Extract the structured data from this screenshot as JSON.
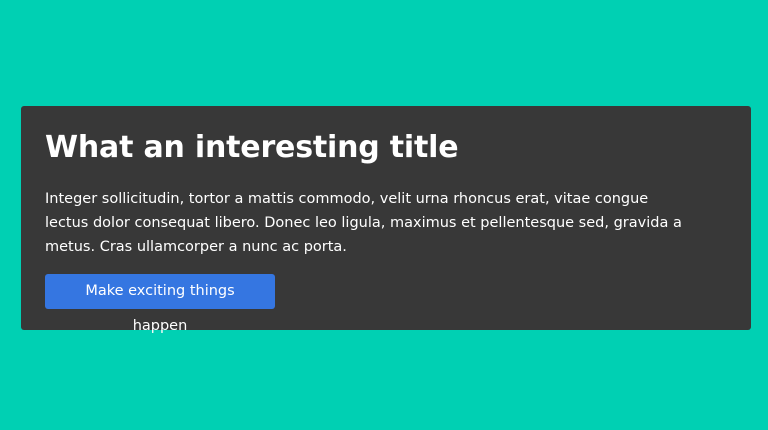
{
  "page": {
    "background_color": "#00d0b3"
  },
  "card": {
    "background_color": "#383838",
    "title": "What an interesting title",
    "body": "Integer sollicitudin, tortor a mattis commodo, velit urna rhoncus erat, vitae congue lectus dolor consequat libero. Donec leo ligula, maximus et pellentesque sed, gravida a metus. Cras ullamcorper a nunc ac porta.",
    "button": {
      "label": "Make exciting things happen",
      "color": "#3576e1"
    }
  }
}
